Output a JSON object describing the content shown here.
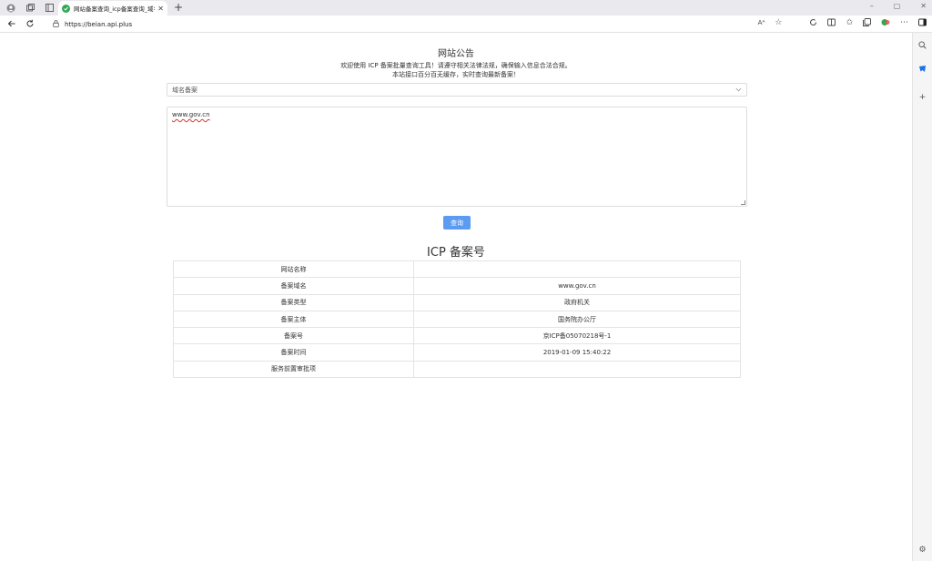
{
  "browser": {
    "tab_title": "网站备案查询_icp备案查询_域名备案查询",
    "url": "https://beian.api.plus",
    "window_controls": [
      "–",
      "▢",
      "✕"
    ]
  },
  "notice": {
    "title": "网站公告",
    "line1": "欢迎使用 ICP 备案批量查询工具！请遵守相关法律法规，确保输入信息合法合规。",
    "line2": "本站接口百分百无缓存，实时查询最新备案！"
  },
  "form": {
    "select_value": "域名备案",
    "textarea_value": "www.gov.cn",
    "query_label": "查询"
  },
  "results": {
    "title": "ICP 备案号",
    "rows": [
      {
        "key": "网站名称",
        "value": ""
      },
      {
        "key": "备案域名",
        "value": "www.gov.cn"
      },
      {
        "key": "备案类型",
        "value": "政府机关"
      },
      {
        "key": "备案主体",
        "value": "国务院办公厅"
      },
      {
        "key": "备案号",
        "value": "京ICP备05070218号-1"
      },
      {
        "key": "备案时间",
        "value": "2019-01-09 15:40:22"
      },
      {
        "key": "服务前置审批项",
        "value": ""
      }
    ]
  },
  "colors": {
    "accent": "#5b9bf2",
    "favicon": "#2fa84f"
  }
}
